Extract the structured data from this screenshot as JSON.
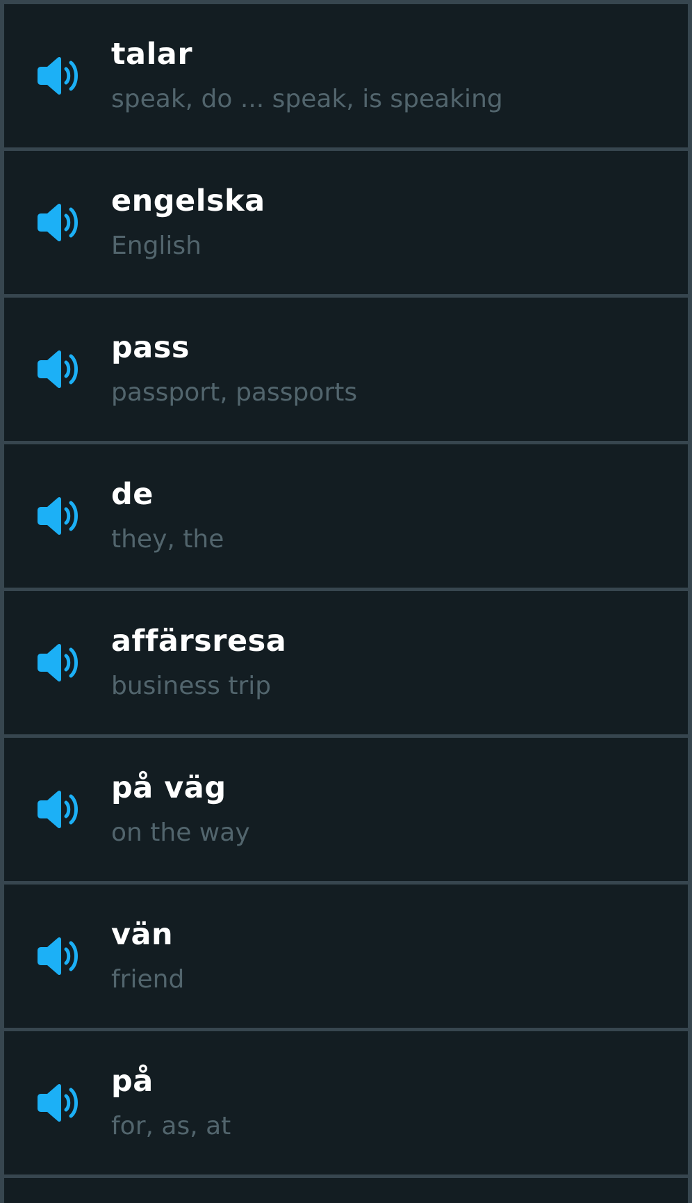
{
  "colors": {
    "background": "#131d22",
    "border": "#37464f",
    "word": "#ffffff",
    "translation": "#52656d",
    "speaker_icon": "#1cb0f6"
  },
  "vocabulary": [
    {
      "word": "talar",
      "translation": "speak, do ... speak, is speaking",
      "icon": "speaker-icon"
    },
    {
      "word": "engelska",
      "translation": "English",
      "icon": "speaker-icon"
    },
    {
      "word": "pass",
      "translation": "passport, passports",
      "icon": "speaker-icon"
    },
    {
      "word": "de",
      "translation": "they, the",
      "icon": "speaker-icon"
    },
    {
      "word": "affärsresa",
      "translation": "business trip",
      "icon": "speaker-icon"
    },
    {
      "word": "på väg",
      "translation": "on the way",
      "icon": "speaker-icon"
    },
    {
      "word": "vän",
      "translation": "friend",
      "icon": "speaker-icon"
    },
    {
      "word": "på",
      "translation": "for, as, at",
      "icon": "speaker-icon"
    }
  ]
}
